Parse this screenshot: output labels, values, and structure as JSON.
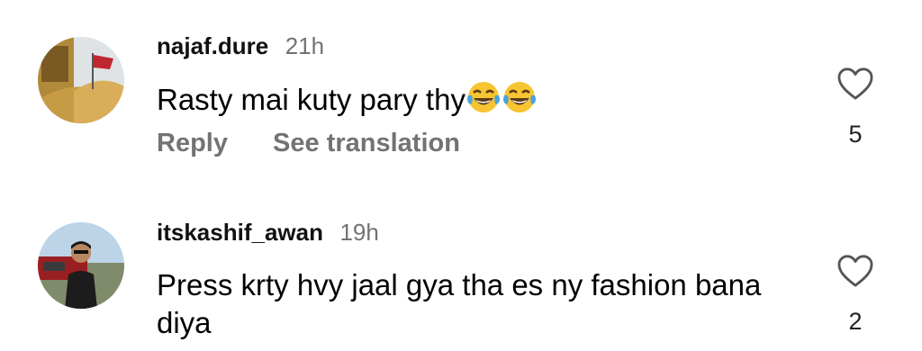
{
  "comments": [
    {
      "username": "najaf.dure",
      "time": "21h",
      "text": "Rasty mai kuty pary thy",
      "emoji": [
        "face-with-tears-of-joy-icon",
        "face-with-tears-of-joy-icon"
      ],
      "reply_label": "Reply",
      "translate_label": "See translation",
      "likes": "5"
    },
    {
      "username": "itskashif_awan",
      "time": "19h",
      "text": "Press krty hvy jaal gya tha es ny fashion bana diya",
      "likes": "2"
    }
  ]
}
